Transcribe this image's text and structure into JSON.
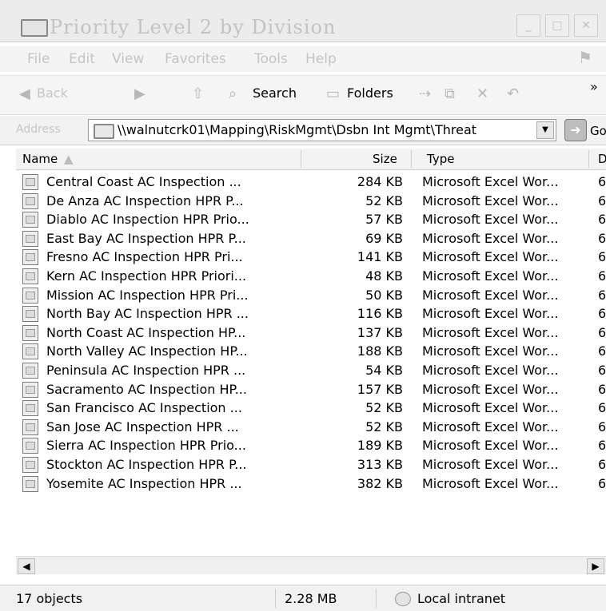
{
  "window": {
    "title": "Priority Level 2 by Division",
    "buttons": [
      "minimize",
      "maximize",
      "close"
    ]
  },
  "menu": [
    "File",
    "Edit",
    "View",
    "Favorites",
    "Tools",
    "Help"
  ],
  "toolbar": {
    "back_label": "Back",
    "search_label": "Search",
    "folders_label": "Folders",
    "more_label": "»"
  },
  "address": {
    "label": "Address",
    "path": "\\\\walnutcrk01\\Mapping\\RiskMgmt\\Dsbn Int Mgmt\\Threat",
    "go_label": "Go"
  },
  "columns": {
    "name": "Name",
    "size": "Size",
    "type": "Type",
    "date": "D"
  },
  "files": [
    {
      "name": "Central Coast AC Inspection ...",
      "size": "284 KB",
      "type": "Microsoft Excel Wor...",
      "date": "6,"
    },
    {
      "name": "De Anza AC Inspection HPR P...",
      "size": "52 KB",
      "type": "Microsoft Excel Wor...",
      "date": "6,"
    },
    {
      "name": "Diablo AC Inspection HPR Prio...",
      "size": "57 KB",
      "type": "Microsoft Excel Wor...",
      "date": "6,"
    },
    {
      "name": "East Bay AC Inspection HPR P...",
      "size": "69 KB",
      "type": "Microsoft Excel Wor...",
      "date": "6,"
    },
    {
      "name": "Fresno AC Inspection HPR Pri...",
      "size": "141 KB",
      "type": "Microsoft Excel Wor...",
      "date": "6,"
    },
    {
      "name": "Kern AC Inspection HPR Priori...",
      "size": "48 KB",
      "type": "Microsoft Excel Wor...",
      "date": "6,"
    },
    {
      "name": "Mission AC Inspection HPR Pri...",
      "size": "50 KB",
      "type": "Microsoft Excel Wor...",
      "date": "6,"
    },
    {
      "name": "North Bay AC Inspection HPR ...",
      "size": "116 KB",
      "type": "Microsoft Excel Wor...",
      "date": "6,"
    },
    {
      "name": "North Coast AC Inspection HP...",
      "size": "137 KB",
      "type": "Microsoft Excel Wor...",
      "date": "6,"
    },
    {
      "name": "North Valley AC Inspection HP...",
      "size": "188 KB",
      "type": "Microsoft Excel Wor...",
      "date": "6,"
    },
    {
      "name": "Peninsula AC Inspection HPR ...",
      "size": "54 KB",
      "type": "Microsoft Excel Wor...",
      "date": "6,"
    },
    {
      "name": "Sacramento AC Inspection HP...",
      "size": "157 KB",
      "type": "Microsoft Excel Wor...",
      "date": "6,"
    },
    {
      "name": "San Francisco AC Inspection ...",
      "size": "52 KB",
      "type": "Microsoft Excel Wor...",
      "date": "6,"
    },
    {
      "name": "San Jose AC Inspection HPR ...",
      "size": "52 KB",
      "type": "Microsoft Excel Wor...",
      "date": "6,"
    },
    {
      "name": "Sierra AC Inspection HPR Prio...",
      "size": "189 KB",
      "type": "Microsoft Excel Wor...",
      "date": "6,"
    },
    {
      "name": "Stockton AC Inspection HPR P...",
      "size": "313 KB",
      "type": "Microsoft Excel Wor...",
      "date": "6,"
    },
    {
      "name": "Yosemite AC Inspection HPR ...",
      "size": "382 KB",
      "type": "Microsoft Excel Wor...",
      "date": "6,"
    }
  ],
  "status": {
    "objects": "17 objects",
    "total_size": "2.28 MB",
    "zone": "Local intranet"
  }
}
